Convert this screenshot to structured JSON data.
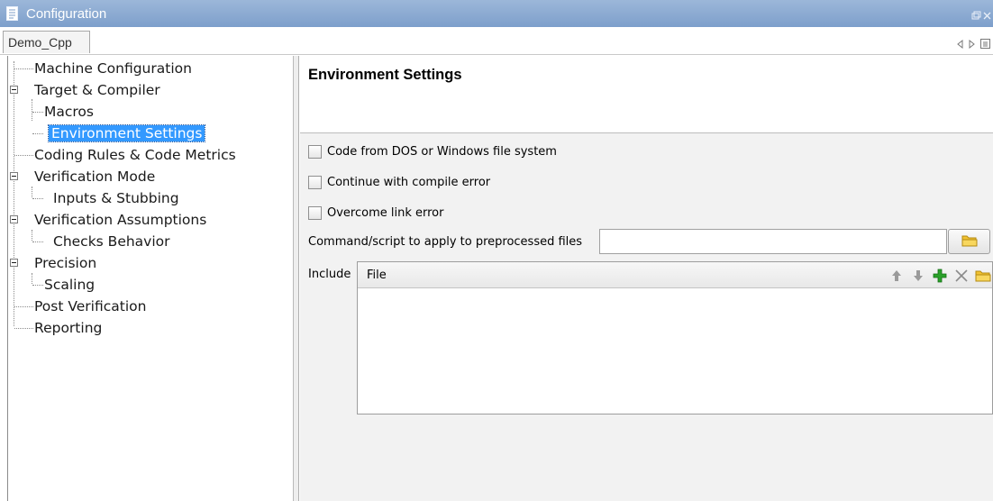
{
  "window": {
    "title": "Configuration"
  },
  "tabs": [
    {
      "label": "Demo_Cpp"
    }
  ],
  "tree": {
    "items": [
      {
        "label": "Machine Configuration"
      },
      {
        "label": "Target & Compiler"
      },
      {
        "label": "Macros"
      },
      {
        "label": "Environment Settings"
      },
      {
        "label": "Coding Rules & Code Metrics"
      },
      {
        "label": "Verification Mode"
      },
      {
        "label": "Inputs & Stubbing"
      },
      {
        "label": "Verification Assumptions"
      },
      {
        "label": "Checks Behavior"
      },
      {
        "label": "Precision"
      },
      {
        "label": "Scaling"
      },
      {
        "label": "Post Verification"
      },
      {
        "label": "Reporting"
      }
    ],
    "selected": "Environment Settings"
  },
  "panel": {
    "title": "Environment Settings",
    "checkboxes": [
      {
        "label": "Code from DOS or Windows file system",
        "checked": false
      },
      {
        "label": "Continue with compile error",
        "checked": false
      },
      {
        "label": "Overcome link error",
        "checked": false
      }
    ],
    "command_label": "Command/script to apply to preprocessed files",
    "command_value": "",
    "include_label": "Include",
    "table_header": "File"
  },
  "icons": {
    "titlebar": "document-icon",
    "tab_nav": [
      "prev-tab-icon",
      "next-tab-icon",
      "tab-list-icon"
    ],
    "table_tools": [
      "move-up-icon",
      "move-down-icon",
      "add-icon",
      "remove-icon",
      "folder-icon"
    ]
  },
  "colors": {
    "titlebar": "#8aaad2",
    "selection": "#3399ff",
    "add_green": "#2aa12a",
    "folder_yellow": "#f2c230"
  }
}
